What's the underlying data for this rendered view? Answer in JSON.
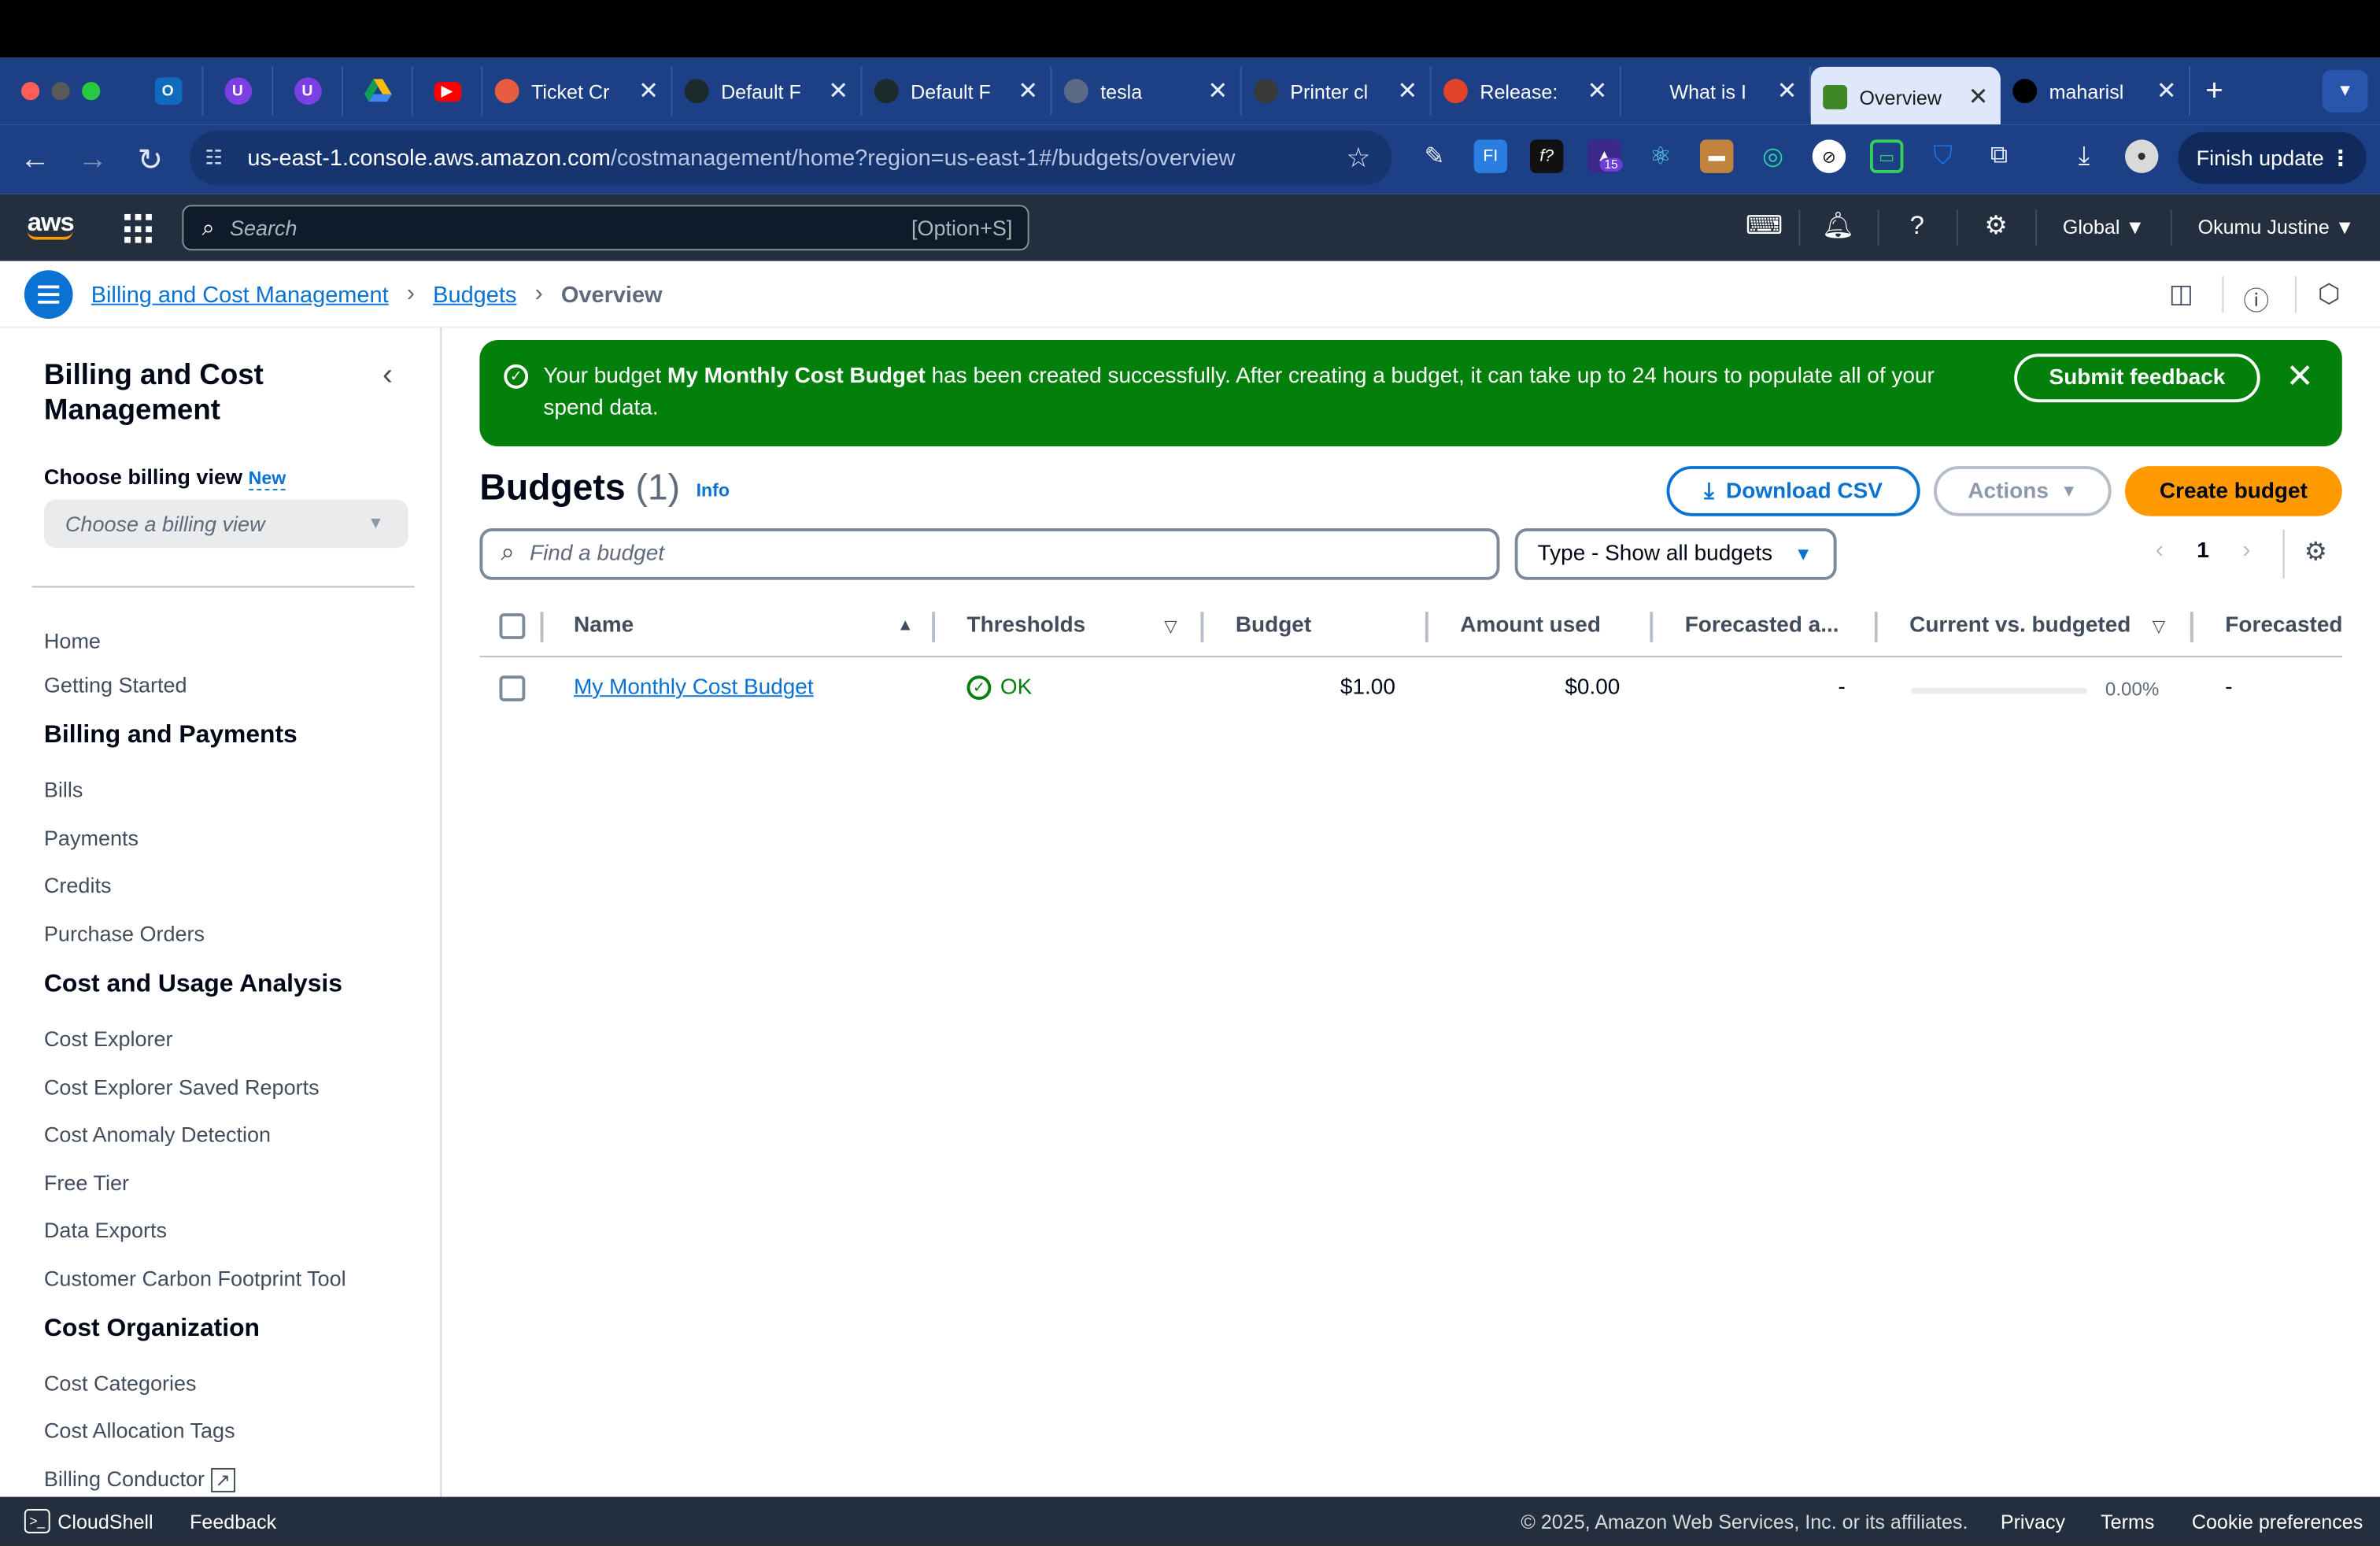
{
  "browser": {
    "tabs": [
      {
        "title": "Ticket Cr",
        "fav_color": "#e85d3f",
        "fav_icon": "clickup-icon"
      },
      {
        "title": "Default F",
        "fav_color": "#1d2a2a",
        "fav_icon": "bolt-icon"
      },
      {
        "title": "Default F",
        "fav_color": "#1d2a2a",
        "fav_icon": "bolt-icon"
      },
      {
        "title": "tesla",
        "fav_color": "#5b6a86",
        "fav_icon": "globe-icon"
      },
      {
        "title": "Printer cl",
        "fav_color": "#3a3a3a",
        "fav_icon": "openai-icon"
      },
      {
        "title": "Release:",
        "fav_color": "#e24329",
        "fav_icon": "gitlab-icon"
      },
      {
        "title": "What is I",
        "fav_color": "#1c3f85",
        "fav_icon": "helm-icon"
      },
      {
        "title": "Overview",
        "fav_color": "#3f8624",
        "fav_icon": "aws-budget-icon"
      },
      {
        "title": "maharisl",
        "fav_color": "#000000",
        "fav_icon": "github-icon"
      }
    ],
    "url_host": "us-east-1.console.aws.amazon.com",
    "url_path": "/costmanagement/home?region=us-east-1#/budgets/overview",
    "finish_update_label": "Finish update",
    "ext_badge": "15"
  },
  "aws_nav": {
    "logo": "aws",
    "search_placeholder": "Search",
    "search_shortcut": "[Option+S]",
    "region": "Global ▼",
    "account": "Okumu Justine ▼"
  },
  "breadcrumb": {
    "items": [
      "Billing and Cost Management",
      "Budgets"
    ],
    "current": "Overview"
  },
  "sidebar": {
    "title": "Billing and Cost Management",
    "choose_label": "Choose billing view",
    "new_badge": "New",
    "select_placeholder": "Choose a billing view",
    "top_items": [
      "Home",
      "Getting Started"
    ],
    "sections": [
      {
        "heading": "Billing and Payments",
        "items": [
          "Bills",
          "Payments",
          "Credits",
          "Purchase Orders"
        ]
      },
      {
        "heading": "Cost and Usage Analysis",
        "items": [
          "Cost Explorer",
          "Cost Explorer Saved Reports",
          "Cost Anomaly Detection",
          "Free Tier",
          "Data Exports",
          "Customer Carbon Footprint Tool"
        ]
      },
      {
        "heading": "Cost Organization",
        "items": [
          "Cost Categories",
          "Cost Allocation Tags",
          "Billing Conductor"
        ]
      }
    ]
  },
  "flash": {
    "prefix": "Your budget ",
    "budget_name": "My Monthly Cost Budget",
    "suffix": " has been created successfully. After creating a budget, it can take up to 24 hours to populate all of your spend data.",
    "feedback_label": "Submit feedback"
  },
  "budgets": {
    "title": "Budgets",
    "count": "(1)",
    "info": "Info",
    "download_label": "Download CSV",
    "actions_label": "Actions",
    "create_label": "Create budget",
    "find_placeholder": "Find a budget",
    "type_filter": "Type - Show all budgets",
    "page": "1",
    "columns": [
      "Name",
      "Thresholds",
      "Budget",
      "Amount used",
      "Forecasted a...",
      "Current vs. budgeted",
      "Forecasted"
    ],
    "rows": [
      {
        "name": "My Monthly Cost Budget",
        "threshold": "OK",
        "budget": "$1.00",
        "amount_used": "$0.00",
        "forecasted_amount": "-",
        "current_vs_budgeted_pct": "0.00%",
        "current_vs_budgeted_fraction": 0,
        "forecasted": "-"
      }
    ]
  },
  "footer": {
    "cloudshell": "CloudShell",
    "feedback": "Feedback",
    "copyright": "© 2025, Amazon Web Services, Inc. or its affiliates.",
    "privacy": "Privacy",
    "terms": "Terms",
    "cookies": "Cookie preferences"
  },
  "colors": {
    "aws_nav_bg": "#232f3e",
    "accent_blue": "#0972d3",
    "success_green": "#037f0c",
    "primary_orange": "#ff9900",
    "browser_chrome": "#1c3f85"
  }
}
